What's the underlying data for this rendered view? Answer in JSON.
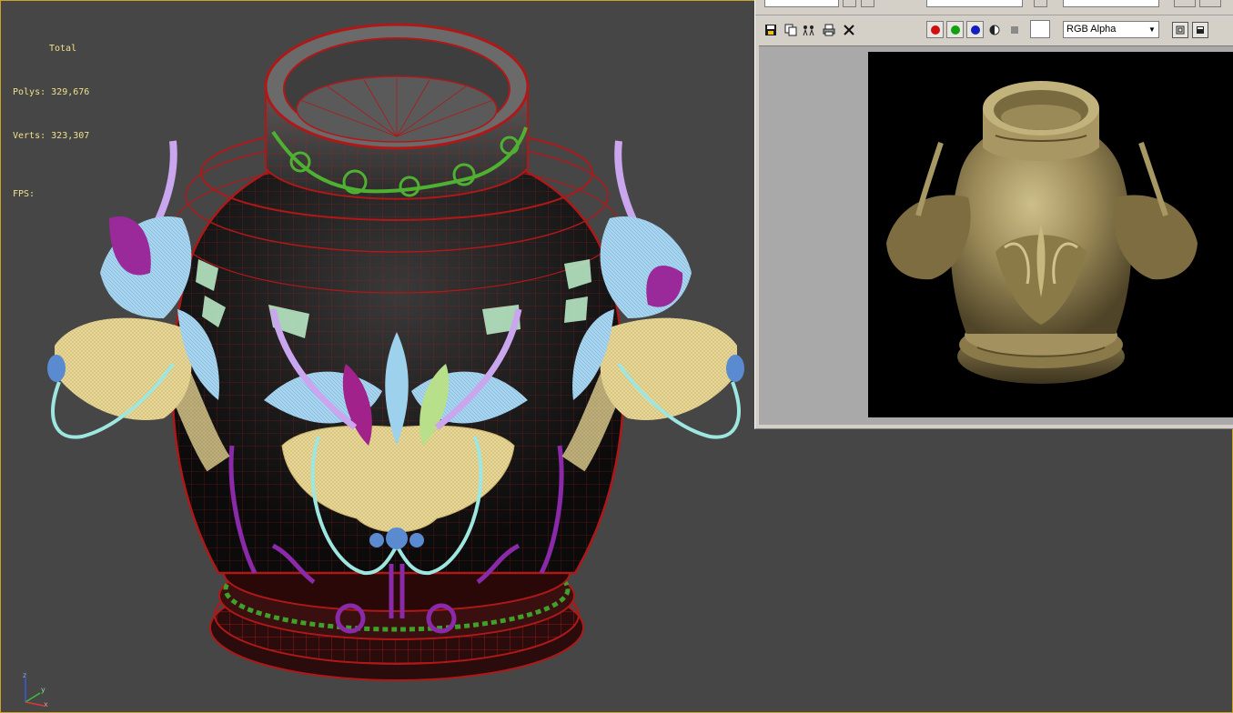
{
  "viewport": {
    "stats": {
      "total_label": "Total",
      "polys_label": "Polys:",
      "polys_value": "329,676",
      "verts_label": "Verts:",
      "verts_value": "323,307",
      "fps_label": "FPS:"
    },
    "axis": {
      "z": "z",
      "y": "y",
      "x": "x"
    },
    "colors": {
      "background": "#464646",
      "text": "#f0e08a",
      "wire_body": "#b01818",
      "accent_border": "#c9a227"
    }
  },
  "frame_window": {
    "toolbar": {
      "save_icon": "save-icon",
      "copy_icon": "copy-icon",
      "clone_icon": "clone-icon",
      "print_icon": "print-icon",
      "clear_icon": "clear-icon",
      "channels": [
        {
          "name": "red-channel",
          "color": "#d01010"
        },
        {
          "name": "green-channel",
          "color": "#10a010"
        },
        {
          "name": "blue-channel",
          "color": "#1020c0"
        }
      ],
      "channel_display": "RGB Alpha"
    }
  }
}
